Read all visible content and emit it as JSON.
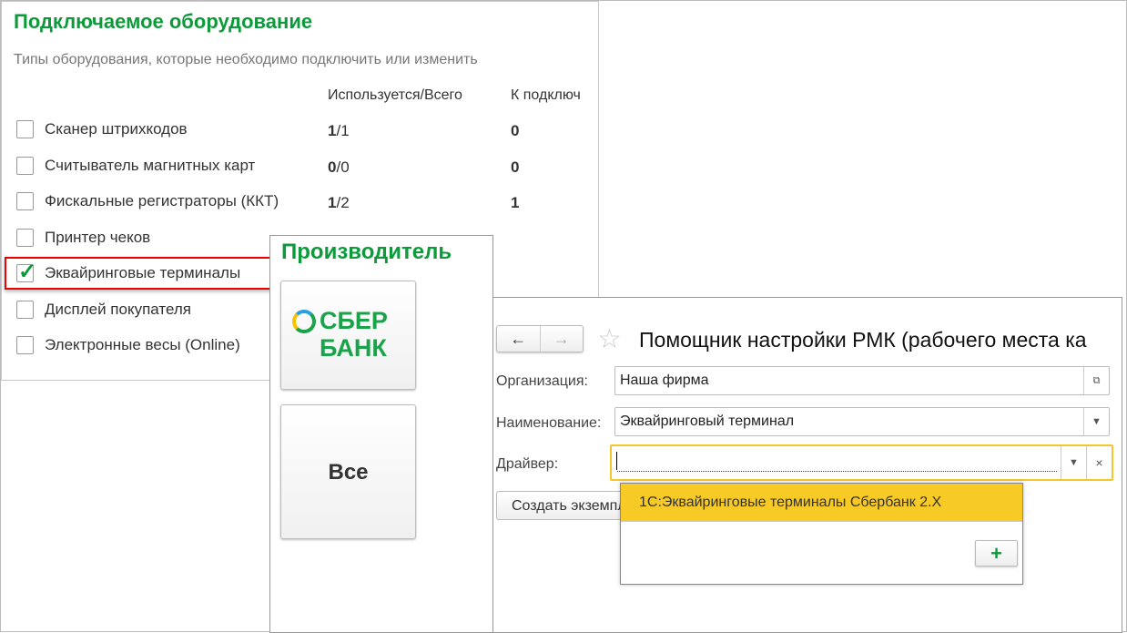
{
  "equipment": {
    "title": "Подключаемое оборудование",
    "subtitle": "Типы оборудования, которые необходимо подключить или изменить",
    "columns": [
      "Используется/Всего",
      "К подключ"
    ],
    "rows": [
      {
        "label": "Сканер штрихкодов",
        "used": "1",
        "total": "/1",
        "to_connect": "0",
        "checked": false
      },
      {
        "label": "Считыватель магнитных карт",
        "used": "0",
        "total": "/0",
        "to_connect": "0",
        "checked": false
      },
      {
        "label": "Фискальные регистраторы (ККТ)",
        "used": "1",
        "total": "/2",
        "to_connect": "1",
        "checked": false
      },
      {
        "label": "Принтер чеков",
        "used": "",
        "total": "",
        "to_connect": "",
        "checked": false
      },
      {
        "label": "Эквайринговые терминалы",
        "used": "",
        "total": "",
        "to_connect": "",
        "checked": true
      },
      {
        "label": "Дисплей покупателя",
        "used": "",
        "total": "",
        "to_connect": "",
        "checked": false
      },
      {
        "label": "Электронные весы (Online)",
        "used": "",
        "total": "",
        "to_connect": "",
        "checked": false
      }
    ]
  },
  "manufacturer": {
    "title": "Производитель",
    "sber_line1": "СБЕР",
    "sber_line2": "БАНК",
    "all_label": "Все"
  },
  "wizard": {
    "back_icon": "←",
    "forward_icon": "→",
    "star_icon": "☆",
    "title": "Помощник настройки РМК (рабочего места ка",
    "org_label": "Организация:",
    "org_value": "Наша фирма",
    "name_label": "Наименование:",
    "name_value": "Эквайринговый терминал",
    "driver_label": "Драйвер:",
    "driver_value": "",
    "create_label": "Создать экземпляр",
    "dropdown_item": "1С:Эквайринговые терминалы Сбербанк 2.X",
    "add_icon": "+"
  },
  "colors": {
    "accent_green": "#0d9a3a",
    "highlight_yellow": "#f8ca25",
    "callout_red": "#ee0000"
  }
}
